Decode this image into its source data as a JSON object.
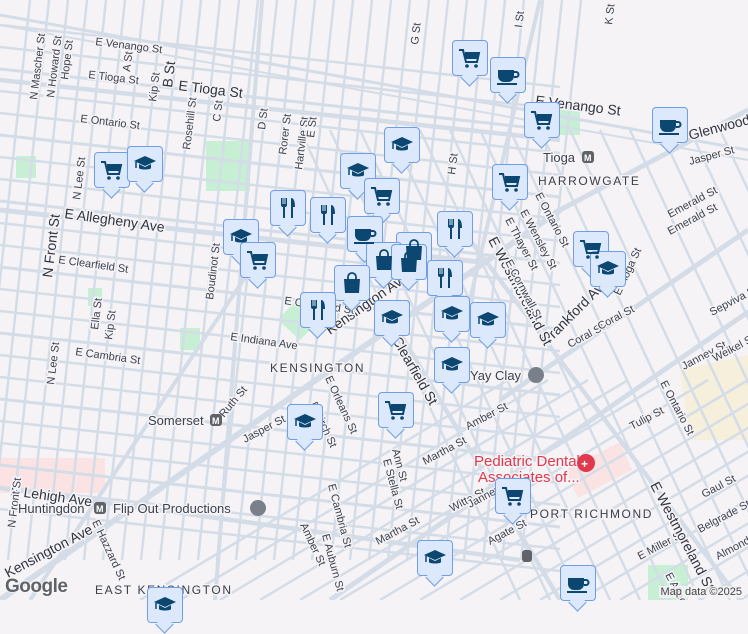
{
  "map": {
    "attribution": "Map data ©2025",
    "logo": "Google",
    "neighborhoods": [
      "HARROWGATE",
      "KENSINGTON",
      "PORT RICHMOND",
      "EAST KENSINGTON"
    ],
    "pois": {
      "tioga": "Tioga",
      "somerset": "Somerset",
      "huntingdon": "Huntingdon",
      "flipout": "Flip Out Productions",
      "yayclay": "Yay Clay",
      "dental1": "Pediatric Dental",
      "dental2": "Associates of..."
    },
    "streets": [
      "E Venango St",
      "E Tioga St",
      "E Tioga St",
      "E Ontario St",
      "E Allegheny Ave",
      "E Clearfield St",
      "E Indiana Ave",
      "E Cambria St",
      "E Lehigh Ave",
      "Kensington Ave",
      "Frankford Ave",
      "Clearfield St",
      "E Westmoreland St",
      "E Venango St",
      "Glenwood",
      "Jasper St",
      "Emerald St",
      "Coral St",
      "Amber St",
      "Martha St",
      "Agate St",
      "Tulip St",
      "Janney St",
      "Weikel St",
      "Sepviva St",
      "E Ontario St",
      "Gaul St",
      "Belgrade St",
      "Almond St",
      "E Miller St",
      "N Front St",
      "N Front St",
      "B St",
      "Kip St",
      "A St",
      "N Lee St",
      "Rosehill St",
      "C St",
      "D St",
      "Rorer St",
      "Hartville St",
      "E St",
      "G St",
      "H St",
      "I St",
      "K St",
      "N Mascher St",
      "N Howard St",
      "Hope St",
      "Boudinot St",
      "Ruth St",
      "E Orleans St",
      "Ann St",
      "E Stella St",
      "E Cambria St",
      "E Auburn St",
      "Amber St",
      "E Hazzard St",
      "Kensington Ave",
      "Witte St",
      "E Thayer St",
      "E Wensley St",
      "E Cornwall St",
      "E Ontario St",
      "Emerald St",
      "Coral St",
      "E Tioga St",
      "Janney St",
      "Ella St",
      "Kip St",
      "N Lee St",
      "E Clearfield St",
      "E Westmoreland St",
      "E Allegheny Ave",
      "Jasper St",
      "Martha St",
      "E Birch St"
    ]
  },
  "markers": [
    "cart",
    "coffee",
    "cart",
    "coffee",
    "school",
    "school",
    "cart",
    "school",
    "cart",
    "cart",
    "restaurant",
    "restaurant",
    "school",
    "cart",
    "coffee",
    "restaurant",
    "bag",
    "bag",
    "bag",
    "bag",
    "restaurant",
    "restaurant",
    "cart",
    "school",
    "school",
    "school",
    "school",
    "school",
    "cart",
    "school",
    "cart",
    "school",
    "coffee",
    "school"
  ],
  "colors": {
    "marker_fill": "#dce8fb",
    "marker_border": "#6f9ee6",
    "icon": "#0b4770",
    "road": "#d4dde7",
    "bg": "#f5f3f5",
    "park": "#c6efd4"
  }
}
